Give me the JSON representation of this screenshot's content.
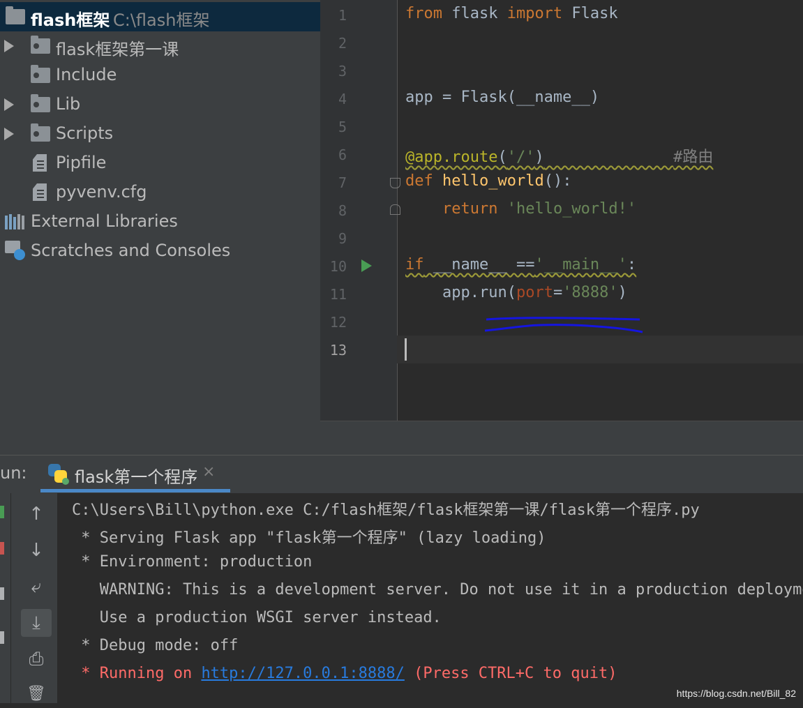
{
  "project": {
    "root_name": "flash框架",
    "root_path": "C:\\flash框架",
    "items": [
      {
        "label": "flask框架第一课",
        "kind": "folder",
        "expandable": true
      },
      {
        "label": "Include",
        "kind": "folder",
        "expandable": false
      },
      {
        "label": "Lib",
        "kind": "folder",
        "expandable": true
      },
      {
        "label": "Scripts",
        "kind": "folder",
        "expandable": true
      },
      {
        "label": "Pipfile",
        "kind": "file",
        "expandable": false
      },
      {
        "label": "pyvenv.cfg",
        "kind": "file",
        "expandable": false
      }
    ],
    "external_libraries": "External Libraries",
    "scratches": "Scratches and Consoles"
  },
  "editor": {
    "line_numbers": [
      "1",
      "2",
      "3",
      "4",
      "5",
      "6",
      "7",
      "8",
      "9",
      "10",
      "11",
      "12",
      "13"
    ],
    "active_line": "13",
    "lines": {
      "l1": {
        "t1": "from",
        "t2": " flask ",
        "t3": "import",
        "t4": " Flask"
      },
      "l4": {
        "t1": "app = Flask(__name__)"
      },
      "l6": {
        "t1": "@app.route",
        "t2": "(",
        "t3": "'/'",
        "t4": ")",
        "t5": "              ",
        "t6": "#路由"
      },
      "l7": {
        "t1": "def",
        "t2": " ",
        "t3": "hello_world",
        "t4": "():"
      },
      "l8": {
        "t1": "    ",
        "t2": "return",
        "t3": " ",
        "t4": "'hello_world!'"
      },
      "l10": {
        "t1": "if",
        "t2": " __name__ ==",
        "t3": "'__main__'",
        "t4": ":"
      },
      "l11": {
        "t1": "    app.run(",
        "t2": "port",
        "t3": "=",
        "t4": "'8888'",
        "t5": ")"
      }
    }
  },
  "run": {
    "label": "un:",
    "tab_label": "flask第一个程序",
    "close_glyph": "×",
    "tools": {
      "up": "↑",
      "down": "↓",
      "wrap": "⤶",
      "scroll_end": "⤓",
      "print": "⎙",
      "trash": "🗑"
    },
    "console": {
      "l1": "C:\\Users\\Bill\\python.exe C:/flash框架/flask框架第一课/flask第一个程序.py",
      "l2": " * Serving Flask app \"flask第一个程序\" (lazy loading)",
      "l3": " * Environment: production",
      "l4": "   WARNING: This is a development server. Do not use it in a production deployment.",
      "l5": "   Use a production WSGI server instead.",
      "l6": " * Debug mode: off",
      "l7_pre": " * Running on ",
      "l7_link": "http://127.0.0.1:8888/",
      "l7_post": " (Press CTRL+C to quit)"
    }
  },
  "watermark": "https://blog.csdn.net/Bill_82",
  "colors": {
    "keyword": "#cc7832",
    "function": "#ffc66d",
    "string": "#6a8759",
    "decorator": "#bbb529",
    "comment": "#808080",
    "error": "#ff6b68",
    "link": "#287bde",
    "annotation_scribble": "#1515e0"
  }
}
